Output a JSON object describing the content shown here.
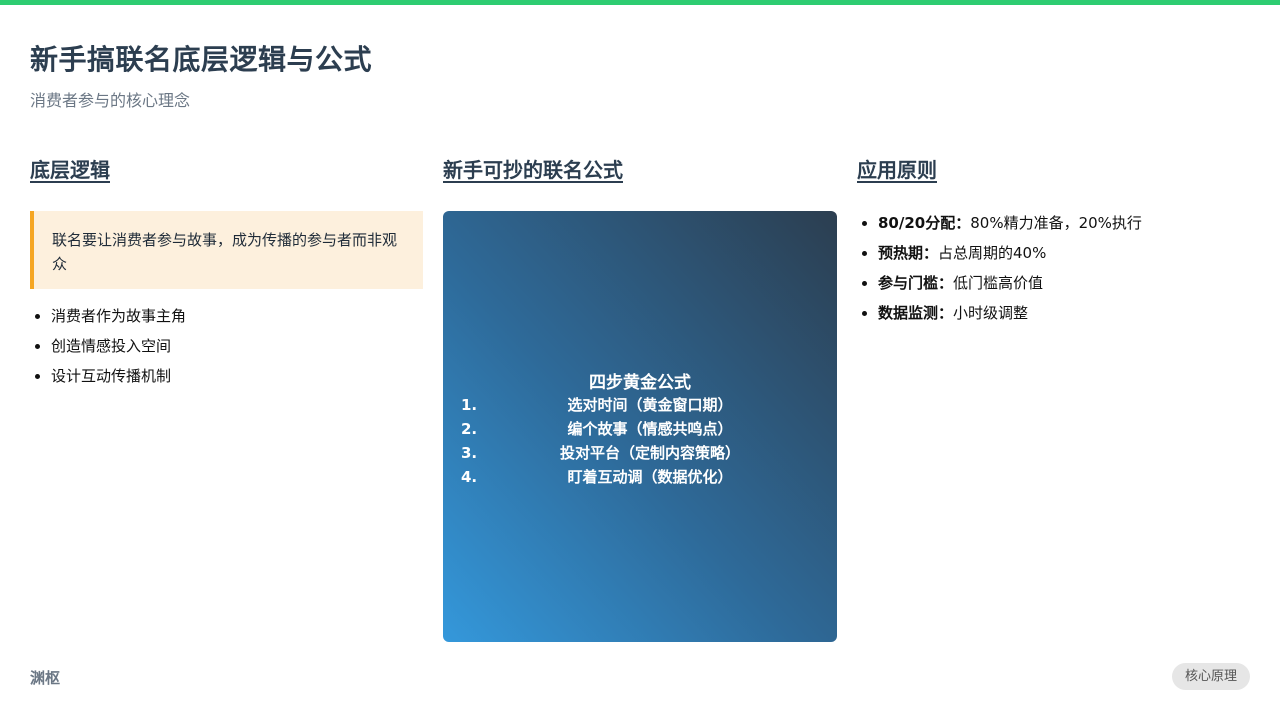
{
  "header": {
    "title": "新手搞联名底层逻辑与公式",
    "subtitle": "消费者参与的核心理念"
  },
  "left": {
    "heading": "底层逻辑",
    "callout": "联名要让消费者参与故事，成为传播的参与者而非观众",
    "bullets": [
      "消费者作为故事主角",
      "创造情感投入空间",
      "设计互动传播机制"
    ]
  },
  "middle": {
    "heading": "新手可抄的联名公式",
    "card_title": "四步黄金公式",
    "steps": [
      {
        "num": "1.",
        "text": "选对时间（黄金窗口期）"
      },
      {
        "num": "2.",
        "text": "编个故事（情感共鸣点）"
      },
      {
        "num": "3.",
        "text": "投对平台（定制内容策略）"
      },
      {
        "num": "4.",
        "text": "盯着互动调（数据优化）"
      }
    ]
  },
  "right": {
    "heading": "应用原则",
    "items": [
      {
        "label": "80/20分配：",
        "text": "80%精力准备，20%执行"
      },
      {
        "label": "预热期：",
        "text": "占总周期的40%"
      },
      {
        "label": "参与门槛：",
        "text": "低门槛高价值"
      },
      {
        "label": "数据监测：",
        "text": "小时级调整"
      }
    ]
  },
  "footer": {
    "brand": "渊枢",
    "badge": "核心原理"
  },
  "colors": {
    "accent_bar": "#2ecc71",
    "callout_border": "#f5a623",
    "callout_bg": "#fdf0dd",
    "card_gradient_start": "#3498db",
    "card_gradient_end": "#2c3e50"
  }
}
